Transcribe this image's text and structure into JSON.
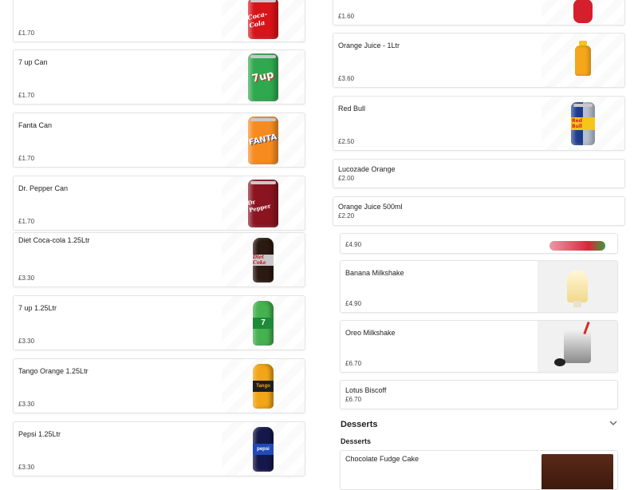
{
  "left_items": [
    {
      "name": "",
      "price": "£1.70",
      "image": "coca-cola-can"
    },
    {
      "name": "7 up Can",
      "price": "£1.70",
      "image": "7up-can"
    },
    {
      "name": "Fanta Can",
      "price": "£1.70",
      "image": "fanta-can"
    },
    {
      "name": "Dr. Pepper Can",
      "price": "£1.70",
      "image": "dr-pepper-can"
    },
    {
      "name": "Diet Coca-cola 1.25Ltr",
      "price": "£3.30",
      "image": "diet-coke-bottle"
    },
    {
      "name": "7 up 1.25Ltr",
      "price": "£3.30",
      "image": "7up-bottle"
    },
    {
      "name": "Tango Orange 1.25Ltr",
      "price": "£3.30",
      "image": "tango-bottle"
    },
    {
      "name": "Pepsi 1.25Ltr",
      "price": "£3.30",
      "image": "pepsi-bottle"
    }
  ],
  "right_items": [
    {
      "name": "",
      "price": "£1.60",
      "image": "strawberry-bottle"
    },
    {
      "name": "Orange Juice - 1Ltr",
      "price": "£3.60",
      "image": "orange-juice-bottle"
    },
    {
      "name": "Red Bull",
      "price": "£2.50",
      "image": "red-bull-can"
    },
    {
      "name": "Lucozade Orange",
      "price": "£2.00"
    },
    {
      "name": "Orange Juice 500ml",
      "price": "£2.20"
    }
  ],
  "milkshakes": [
    {
      "name": "",
      "price": "£4.90",
      "image": "strawberry-milkshake"
    },
    {
      "name": "Banana Milkshake",
      "price": "£4.90",
      "image": "banana-milkshake"
    },
    {
      "name": "Oreo Milkshake",
      "price": "£6.70",
      "image": "oreo-milkshake"
    },
    {
      "name": "Lotus Biscoff",
      "price": "£6.70"
    }
  ],
  "desserts": {
    "title": "Desserts",
    "subtitle": "Desserts",
    "items": [
      {
        "name": "Chocolate Fudge Cake",
        "image": "chocolate-cake"
      }
    ]
  },
  "brand_text": {
    "coke": "Coca-Cola",
    "sevenup": "7up",
    "fanta": "FANTA",
    "drpepper": "Dr Pepper",
    "dietcoke": "Diet Coke",
    "sevenup_bottle": "7",
    "tango": "Tango",
    "pepsi": "pepsi",
    "redbull": "Red Bull"
  }
}
